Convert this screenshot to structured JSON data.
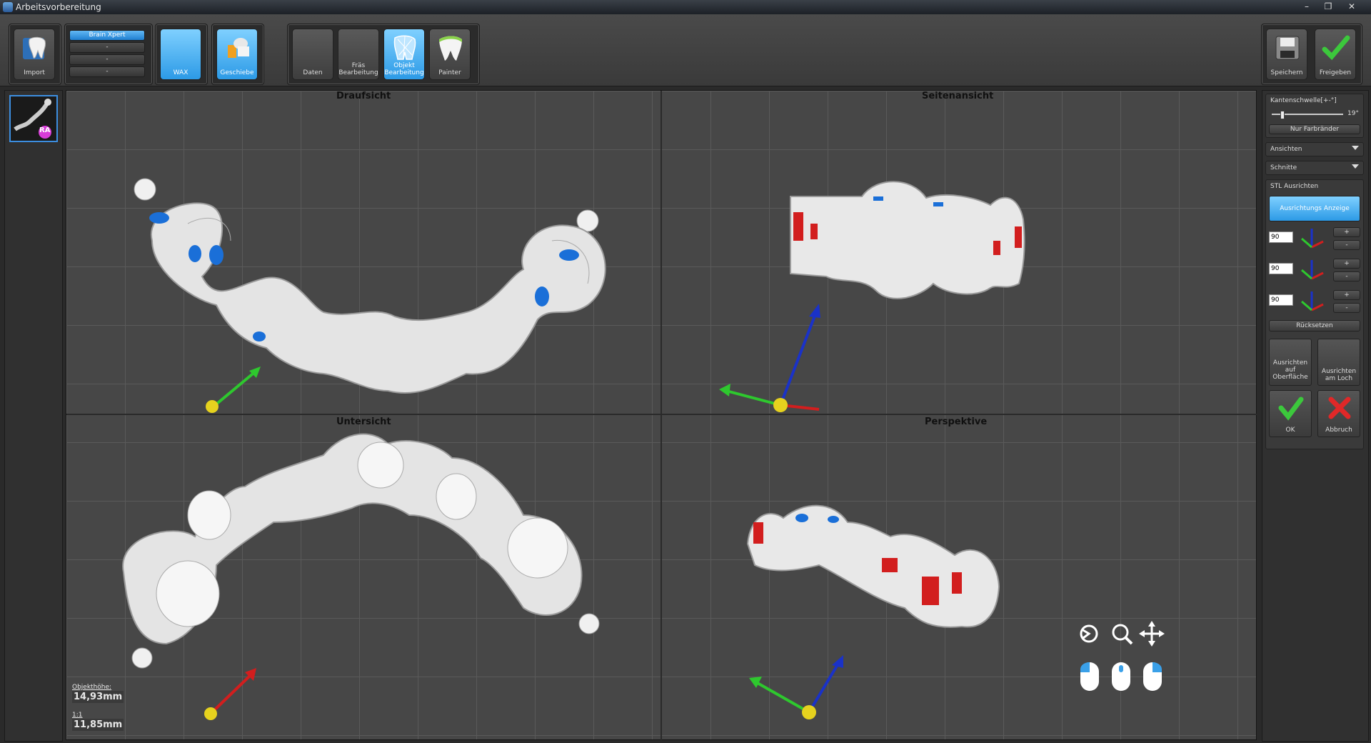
{
  "window": {
    "title": "Arbeitsvorbereitung",
    "minimize": "–",
    "restore": "❐",
    "close": "✕"
  },
  "toolbar": {
    "import_label": "Import",
    "brain_list": [
      "Brain Xpert",
      "-",
      "-",
      "-"
    ],
    "wax_label": "WAX",
    "geschiebe_label": "Geschiebe",
    "daten_label": "Daten",
    "fraes_label": "Fräs Bearbeitung",
    "objekt_label": "Objekt Bearbeitung",
    "painter_label": "Painter",
    "speichern_label": "Speichern",
    "freigeben_label": "Freigeben"
  },
  "thumbnail": {
    "badge": "RA"
  },
  "views": {
    "top": "Draufsicht",
    "side": "Seitenansicht",
    "bottom": "Untersicht",
    "persp": "Perspektive"
  },
  "info": {
    "height_label": "Objekthöhe:",
    "height_value": "14,93mm",
    "scale_label": "1:1",
    "scale_value": "11,85mm"
  },
  "panel": {
    "kanten_label": "Kantenschwelle[+-°]",
    "kanten_value": "19°",
    "kanten_level": 0.12,
    "nur_farbraender": "Nur Farbränder",
    "ansichten": "Ansichten",
    "schnitte": "Schnitte",
    "stl_title": "STL Ausrichten",
    "ausrichtungs_anzeige": "Ausrichtungs Anzeige",
    "angles": [
      "90",
      "90",
      "90"
    ],
    "plus": "+",
    "minus": "-",
    "ruecksetzen": "Rücksetzen",
    "ausrichten_oberflaeche": "Ausrichten auf Oberfläche",
    "ausrichten_loch": "Ausrichten am Loch",
    "ok": "OK",
    "abbruch": "Abbruch"
  },
  "colors": {
    "accent": "#2c9ae6",
    "blue_mark": "#1a6fd8",
    "red_mark": "#d21e1e"
  }
}
